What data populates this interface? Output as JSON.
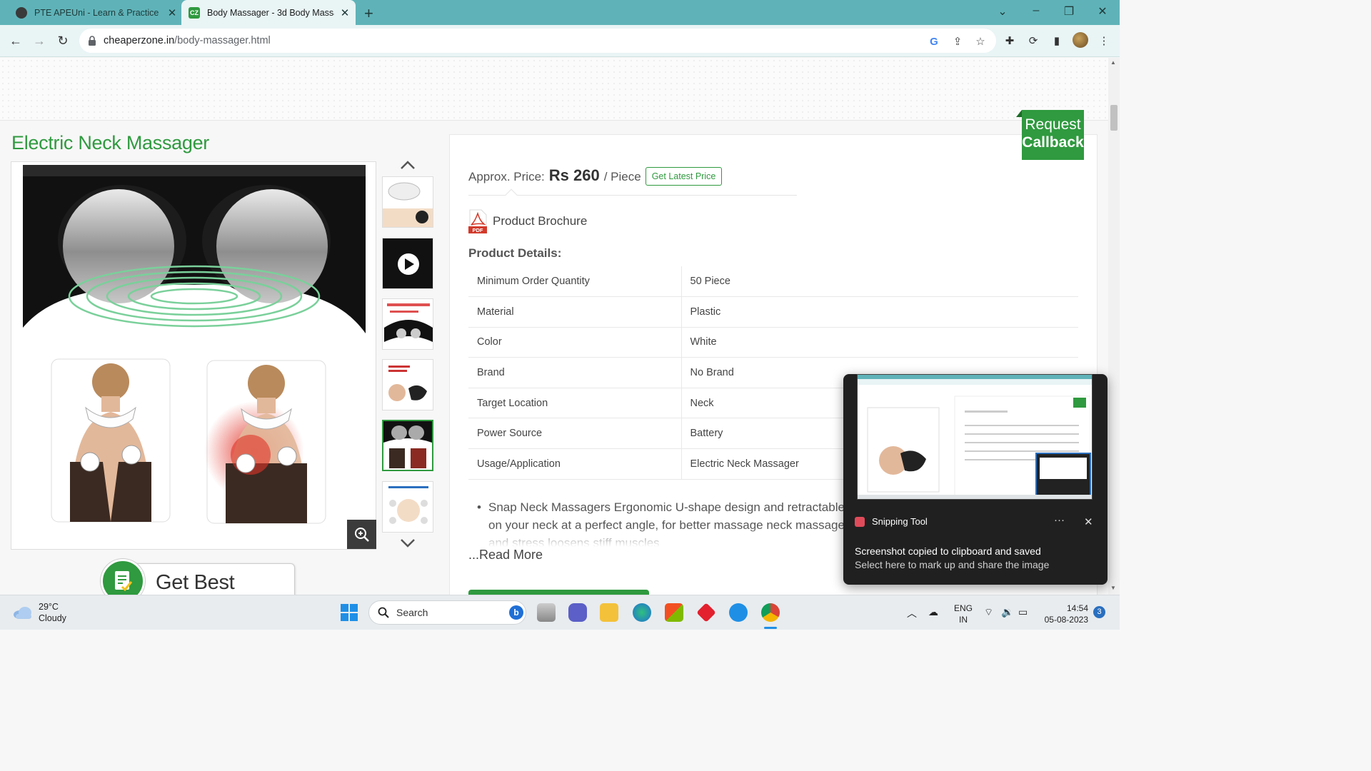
{
  "browser": {
    "tabs": [
      {
        "title": "PTE APEUni - Learn & Practice PTE",
        "active": false
      },
      {
        "title": "Body Massager - 3d Body Massager",
        "active": true
      }
    ],
    "new_tab_label": "+",
    "url_domain": "cheaperzone.in",
    "url_path": "/body-massager.html",
    "favicon_text": "CZ",
    "icons": [
      "back-arrow-icon",
      "forward-arrow-icon",
      "reload-icon",
      "lock-icon",
      "google-icon",
      "share-icon",
      "star-icon",
      "extensions-icon",
      "sync-icon",
      "sidebar-icon",
      "profile-avatar",
      "menu-dots-icon"
    ]
  },
  "product": {
    "title": "Electric Neck Massager",
    "approx_price_label": "Approx. Price:",
    "price": "Rs 260",
    "unit": "/ Piece",
    "latest_price_button": "Get Latest Price",
    "brochure_label": "Product Brochure",
    "pdf_badge": "PDF",
    "details_heading": "Product Details:",
    "specs": [
      {
        "key": "Minimum Order Quantity",
        "value": "50 Piece"
      },
      {
        "key": "Material",
        "value": "Plastic"
      },
      {
        "key": "Color",
        "value": "White"
      },
      {
        "key": "Brand",
        "value": "No Brand"
      },
      {
        "key": "Target Location",
        "value": "Neck"
      },
      {
        "key": "Power Source",
        "value": "Battery"
      },
      {
        "key": "Usage/Application",
        "value": "Electric Neck Massager"
      }
    ],
    "description": "Snap Neck Massagers Ergonomic U-shape design and retractable arms, the massager fits on your neck at a perfect angle, for better massage neck massager provides relaxation and stress loosens stiff muscles",
    "read_more": "...Read More",
    "quote_button": "Get Best Quote",
    "callback_line1": "Request",
    "callback_line2": "Callback",
    "thumbnail_count": 6,
    "selected_thumbnail": 5,
    "accent_color": "#2f9a3f"
  },
  "toast": {
    "app_name": "Snipping Tool",
    "more_label": "···",
    "close_label": "✕",
    "title": "Screenshot copied to clipboard and saved",
    "subtitle": "Select here to mark up and share the image"
  },
  "taskbar": {
    "temperature": "29°C",
    "condition": "Cloudy",
    "search_label": "Search",
    "lang_line1": "ENG",
    "lang_line2": "IN",
    "time": "14:54",
    "date": "05-08-2023",
    "notification_count": "3"
  }
}
